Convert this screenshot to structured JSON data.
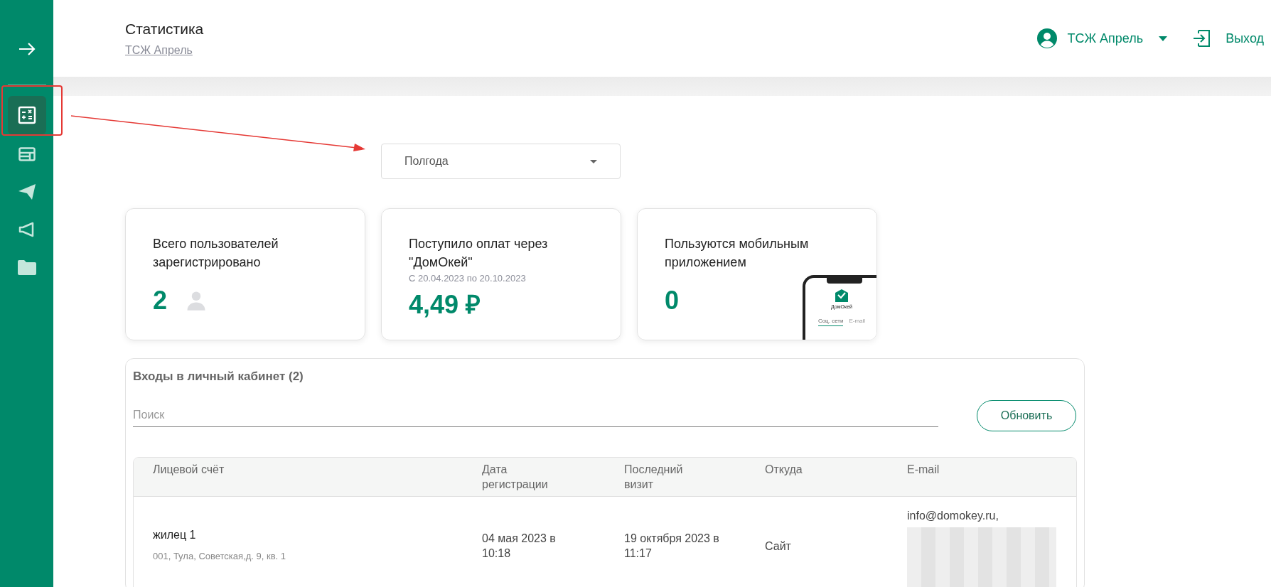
{
  "sidebar": {
    "items": [
      {
        "kind": "calculator",
        "selected": true
      },
      {
        "kind": "layout",
        "selected": false
      },
      {
        "kind": "send",
        "selected": false
      },
      {
        "kind": "megaphone",
        "selected": false
      },
      {
        "kind": "folder",
        "selected": false
      }
    ]
  },
  "header": {
    "title": "Статистика",
    "subtitle": "ТСЖ Апрель",
    "user": "ТСЖ Апрель",
    "logout": "Выход"
  },
  "period": {
    "value": "Полгода"
  },
  "cards": [
    {
      "kind": "users",
      "title": "Всего пользователей зарегистрировано",
      "value": "2"
    },
    {
      "kind": "payments",
      "title": "Поступило оплат через \"ДомОкей\"",
      "note": "С 20.04.2023 по 20.10.2023",
      "value": "4,49 ₽"
    },
    {
      "kind": "mobile",
      "title": "Пользуются мобильным приложением",
      "value": "0",
      "phone": {
        "brand": "ДомОкей",
        "tabs": [
          "Соц. сети",
          "E-mail"
        ]
      }
    }
  ],
  "logins": {
    "title": "Входы в личный кабинет (2)",
    "search": {
      "placeholder": "Поиск"
    },
    "refresh": "Обновить",
    "columns": [
      "Лицевой счёт",
      "Дата регистрации",
      "Последний визит",
      "Откуда",
      "E-mail"
    ],
    "rows": [
      {
        "name": "жилец 1",
        "address": "001, Тула, Советская,д. 9, кв. 1",
        "registered": "04 мая 2023 в 10:18",
        "last_visit": "19 октября 2023 в 11:17",
        "source": "Сайт",
        "email": "info@domokey.ru,"
      }
    ]
  }
}
